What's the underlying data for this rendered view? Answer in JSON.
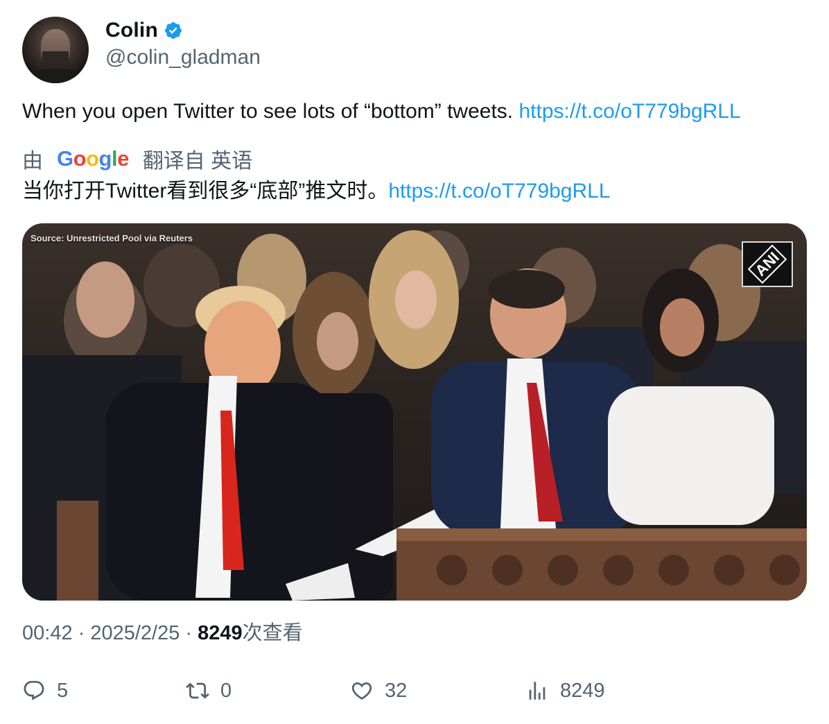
{
  "author": {
    "display_name": "Colin",
    "handle": "@colin_gladman",
    "verified": true
  },
  "tweet": {
    "text": "When you open Twitter to see lots of “bottom” tweets. ",
    "link": "https://t.co/oT779bgRLL"
  },
  "translation": {
    "prefix": "由",
    "provider": "Google",
    "suffix": "翻译自 英语",
    "text": "当你打开Twitter看到很多“底部”推文时。",
    "link": "https://t.co/oT779bgRLL"
  },
  "media": {
    "source_caption": "Source: Unrestricted Pool via Reuters",
    "watermark": "ANI"
  },
  "meta": {
    "time": "00:42",
    "separator": " · ",
    "date": "2025/2/25",
    "views": "8249",
    "views_label": "次查看"
  },
  "actions": {
    "replies": "5",
    "reposts": "0",
    "likes": "32",
    "views": "8249"
  },
  "colors": {
    "link": "#1d9bf0",
    "secondary_text": "#536471",
    "verified": "#1d9bf0"
  },
  "icons": [
    "verified-badge-icon",
    "reply-icon",
    "repost-icon",
    "like-icon",
    "views-icon"
  ]
}
